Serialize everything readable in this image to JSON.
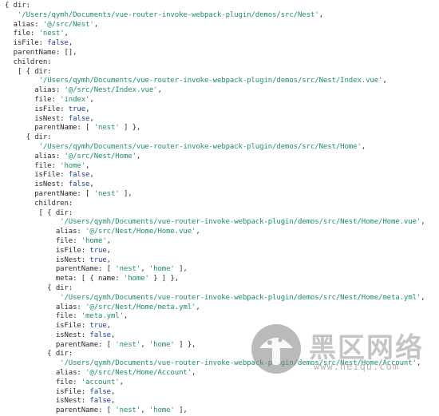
{
  "code_lines": [
    [
      {
        "t": "p",
        "v": "{ dir:"
      }
    ],
    [
      {
        "t": "p",
        "v": "   "
      },
      {
        "t": "str",
        "v": "'/Users/qymh/Documents/vue-router-invoke-webpack-plugin/demos/src/Nest'"
      },
      {
        "t": "p",
        "v": ","
      }
    ],
    [
      {
        "t": "p",
        "v": "  alias: "
      },
      {
        "t": "str",
        "v": "'@/src/Nest'"
      },
      {
        "t": "p",
        "v": ","
      }
    ],
    [
      {
        "t": "p",
        "v": "  file: "
      },
      {
        "t": "str",
        "v": "'nest'"
      },
      {
        "t": "p",
        "v": ","
      }
    ],
    [
      {
        "t": "p",
        "v": "  isFile: "
      },
      {
        "t": "kw",
        "v": "false"
      },
      {
        "t": "p",
        "v": ","
      }
    ],
    [
      {
        "t": "p",
        "v": "  parentName: [],"
      }
    ],
    [
      {
        "t": "p",
        "v": "  children:"
      }
    ],
    [
      {
        "t": "p",
        "v": "   [ { dir:"
      }
    ],
    [
      {
        "t": "p",
        "v": "        "
      },
      {
        "t": "str",
        "v": "'/Users/qymh/Documents/vue-router-invoke-webpack-plugin/demos/src/Nest/Index.vue'"
      },
      {
        "t": "p",
        "v": ","
      }
    ],
    [
      {
        "t": "p",
        "v": "       alias: "
      },
      {
        "t": "str",
        "v": "'@/src/Nest/Index.vue'"
      },
      {
        "t": "p",
        "v": ","
      }
    ],
    [
      {
        "t": "p",
        "v": "       file: "
      },
      {
        "t": "str",
        "v": "'index'"
      },
      {
        "t": "p",
        "v": ","
      }
    ],
    [
      {
        "t": "p",
        "v": "       isFile: "
      },
      {
        "t": "kw",
        "v": "true"
      },
      {
        "t": "p",
        "v": ","
      }
    ],
    [
      {
        "t": "p",
        "v": "       isNest: "
      },
      {
        "t": "kw",
        "v": "false"
      },
      {
        "t": "p",
        "v": ","
      }
    ],
    [
      {
        "t": "p",
        "v": "       parentName: [ "
      },
      {
        "t": "str",
        "v": "'nest'"
      },
      {
        "t": "p",
        "v": " ] },"
      }
    ],
    [
      {
        "t": "p",
        "v": "     { dir:"
      }
    ],
    [
      {
        "t": "p",
        "v": "        "
      },
      {
        "t": "str",
        "v": "'/Users/qymh/Documents/vue-router-invoke-webpack-plugin/demos/src/Nest/Home'"
      },
      {
        "t": "p",
        "v": ","
      }
    ],
    [
      {
        "t": "p",
        "v": "       alias: "
      },
      {
        "t": "str",
        "v": "'@/src/Nest/Home'"
      },
      {
        "t": "p",
        "v": ","
      }
    ],
    [
      {
        "t": "p",
        "v": "       file: "
      },
      {
        "t": "str",
        "v": "'home'"
      },
      {
        "t": "p",
        "v": ","
      }
    ],
    [
      {
        "t": "p",
        "v": "       isFile: "
      },
      {
        "t": "kw",
        "v": "false"
      },
      {
        "t": "p",
        "v": ","
      }
    ],
    [
      {
        "t": "p",
        "v": "       isNest: "
      },
      {
        "t": "kw",
        "v": "false"
      },
      {
        "t": "p",
        "v": ","
      }
    ],
    [
      {
        "t": "p",
        "v": "       parentName: [ "
      },
      {
        "t": "str",
        "v": "'nest'"
      },
      {
        "t": "p",
        "v": " ],"
      }
    ],
    [
      {
        "t": "p",
        "v": "       children:"
      }
    ],
    [
      {
        "t": "p",
        "v": "        [ { dir:"
      }
    ],
    [
      {
        "t": "p",
        "v": "             "
      },
      {
        "t": "str",
        "v": "'/Users/qymh/Documents/vue-router-invoke-webpack-plugin/demos/src/Nest/Home/Home.vue'"
      },
      {
        "t": "p",
        "v": ","
      }
    ],
    [
      {
        "t": "p",
        "v": "            alias: "
      },
      {
        "t": "str",
        "v": "'@/src/Nest/Home/Home.vue'"
      },
      {
        "t": "p",
        "v": ","
      }
    ],
    [
      {
        "t": "p",
        "v": "            file: "
      },
      {
        "t": "str",
        "v": "'home'"
      },
      {
        "t": "p",
        "v": ","
      }
    ],
    [
      {
        "t": "p",
        "v": "            isFile: "
      },
      {
        "t": "kw",
        "v": "true"
      },
      {
        "t": "p",
        "v": ","
      }
    ],
    [
      {
        "t": "p",
        "v": "            isNest: "
      },
      {
        "t": "kw",
        "v": "true"
      },
      {
        "t": "p",
        "v": ","
      }
    ],
    [
      {
        "t": "p",
        "v": "            parentName: [ "
      },
      {
        "t": "str",
        "v": "'nest'"
      },
      {
        "t": "p",
        "v": ", "
      },
      {
        "t": "str",
        "v": "'home'"
      },
      {
        "t": "p",
        "v": " ],"
      }
    ],
    [
      {
        "t": "p",
        "v": "            meta: [ { name: "
      },
      {
        "t": "str",
        "v": "'home'"
      },
      {
        "t": "p",
        "v": " } ] },"
      }
    ],
    [
      {
        "t": "p",
        "v": "          { dir:"
      }
    ],
    [
      {
        "t": "p",
        "v": "             "
      },
      {
        "t": "str",
        "v": "'/Users/qymh/Documents/vue-router-invoke-webpack-plugin/demos/src/Nest/Home/meta.yml'"
      },
      {
        "t": "p",
        "v": ","
      }
    ],
    [
      {
        "t": "p",
        "v": "            alias: "
      },
      {
        "t": "str",
        "v": "'@/src/Nest/Home/meta.yml'"
      },
      {
        "t": "p",
        "v": ","
      }
    ],
    [
      {
        "t": "p",
        "v": "            file: "
      },
      {
        "t": "str",
        "v": "'meta.yml'"
      },
      {
        "t": "p",
        "v": ","
      }
    ],
    [
      {
        "t": "p",
        "v": "            isFile: "
      },
      {
        "t": "kw",
        "v": "true"
      },
      {
        "t": "p",
        "v": ","
      }
    ],
    [
      {
        "t": "p",
        "v": "            isNest: "
      },
      {
        "t": "kw",
        "v": "false"
      },
      {
        "t": "p",
        "v": ","
      }
    ],
    [
      {
        "t": "p",
        "v": "            parentName: [ "
      },
      {
        "t": "str",
        "v": "'nest'"
      },
      {
        "t": "p",
        "v": ", "
      },
      {
        "t": "str",
        "v": "'home'"
      },
      {
        "t": "p",
        "v": " ] },"
      }
    ],
    [
      {
        "t": "p",
        "v": "          { dir:"
      }
    ],
    [
      {
        "t": "p",
        "v": "             "
      },
      {
        "t": "str",
        "v": "'/Users/qymh/Documents/vue-router-invoke-webpack-plugin/demos/src/Nest/Home/Account'"
      },
      {
        "t": "p",
        "v": ","
      }
    ],
    [
      {
        "t": "p",
        "v": "            alias: "
      },
      {
        "t": "str",
        "v": "'@/src/Nest/Home/Account'"
      },
      {
        "t": "p",
        "v": ","
      }
    ],
    [
      {
        "t": "p",
        "v": "            file: "
      },
      {
        "t": "str",
        "v": "'account'"
      },
      {
        "t": "p",
        "v": ","
      }
    ],
    [
      {
        "t": "p",
        "v": "            isFile: "
      },
      {
        "t": "kw",
        "v": "false"
      },
      {
        "t": "p",
        "v": ","
      }
    ],
    [
      {
        "t": "p",
        "v": "            isNest: "
      },
      {
        "t": "kw",
        "v": "false"
      },
      {
        "t": "p",
        "v": ","
      }
    ],
    [
      {
        "t": "p",
        "v": "            parentName: [ "
      },
      {
        "t": "str",
        "v": "'nest'"
      },
      {
        "t": "p",
        "v": ", "
      },
      {
        "t": "str",
        "v": "'home'"
      },
      {
        "t": "p",
        "v": " ],"
      }
    ]
  ],
  "colors": {
    "string": "#1f8f5f",
    "keyword": "#1d3f9a",
    "plain": "#2b2b2b",
    "background": "#ffffff"
  },
  "watermark": {
    "text": "黑区网络",
    "url": "www.heiqu.com",
    "logo_icon": "mushroom-logo-icon"
  }
}
